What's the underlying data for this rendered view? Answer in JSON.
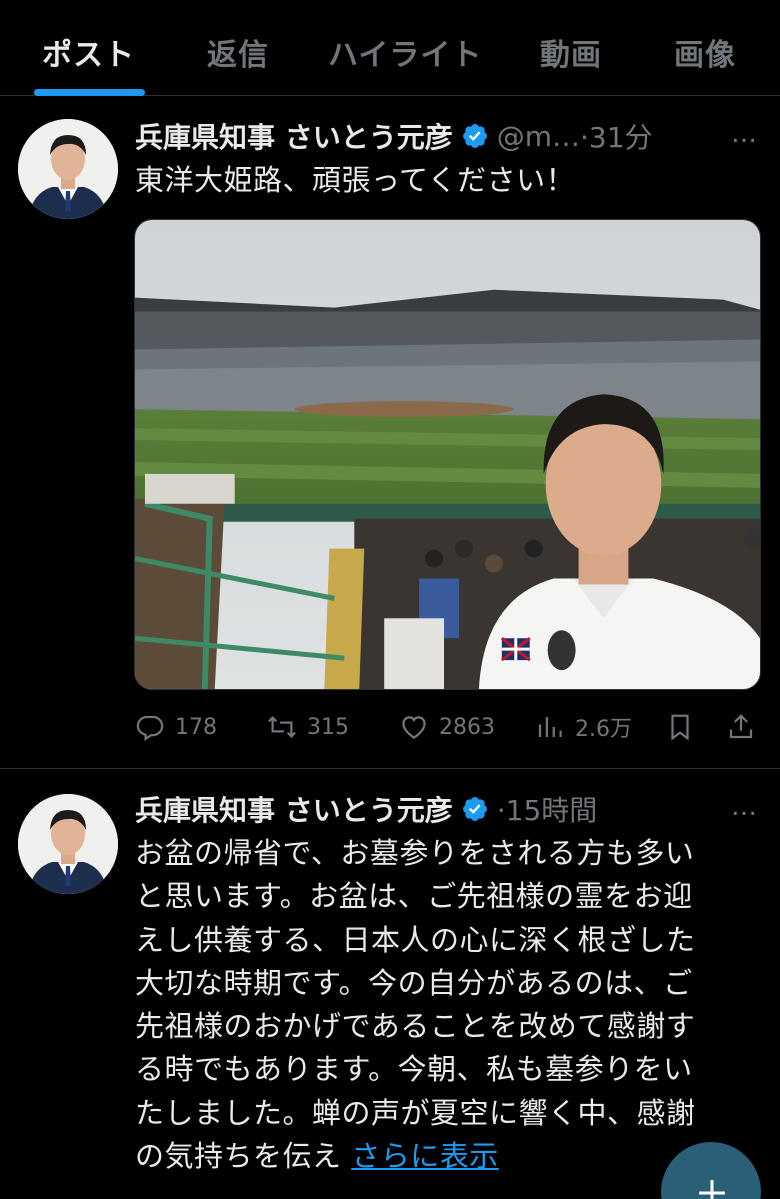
{
  "tabs": [
    {
      "label": "ポスト",
      "active": true
    },
    {
      "label": "返信",
      "active": false
    },
    {
      "label": "ハイライト",
      "active": false
    },
    {
      "label": "動画",
      "active": false
    },
    {
      "label": "画像",
      "active": false
    }
  ],
  "posts": [
    {
      "author_name": "兵庫県知事 さいとう元彦",
      "handle": "@m…",
      "time": "·31分",
      "text": "東洋大姫路、頑張ってください！",
      "stats": {
        "replies": "178",
        "reposts": "315",
        "likes": "2863",
        "views": "2.6万"
      }
    },
    {
      "author_name": "兵庫県知事 さいとう元彦",
      "time": "·15時間",
      "text_lines": [
        "お盆の帰省で、お墓参りをされる方も多い",
        "と思います。お盆は、ご先祖様の霊をお迎",
        "えし供養する、日本人の心に深く根ざした",
        "大切な時期です。今の自分があるのは、ご",
        "先祖様のおかげであることを改めて感謝す",
        "る時でもあります。今朝、私も墓参りをい",
        "たしました。蝉の声が夏空に響く中、感謝"
      ],
      "text_last": "の気持ちを伝え",
      "show_more": "さらに表示"
    }
  ],
  "more_icon": "…",
  "colors": {
    "accent": "#1d9bf0",
    "muted": "#71767b",
    "text": "#e7e9ea",
    "background": "#000000"
  }
}
